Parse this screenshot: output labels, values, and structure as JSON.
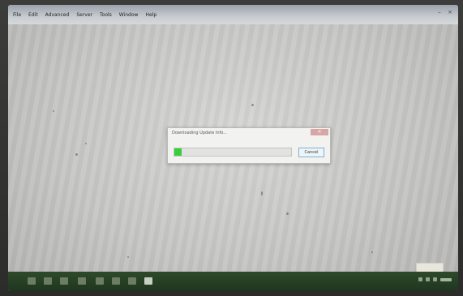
{
  "menubar": {
    "items": [
      "File",
      "Edit",
      "Advanced",
      "Server",
      "Tools",
      "Window",
      "Help"
    ]
  },
  "window_controls": {
    "minimize_glyph": "–",
    "close_glyph": "×"
  },
  "dialog": {
    "title": "Downloading Update Info...",
    "close_glyph": "×",
    "progress_fraction": 0.06,
    "cancel_label": "Cancel"
  },
  "taskbar": {
    "icons": [
      "start-icon",
      "search-icon",
      "task-view-icon",
      "file-explorer-icon",
      "edge-icon",
      "store-icon",
      "mail-icon",
      "app-icon"
    ]
  },
  "colors": {
    "progress": "#3bcc3b",
    "taskbar": "#2e4a2a",
    "dialog_close": "#d9a6a6"
  }
}
